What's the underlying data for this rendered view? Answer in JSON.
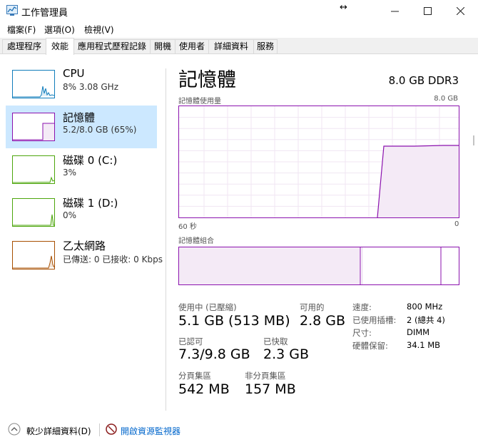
{
  "window": {
    "title": "工作管理員"
  },
  "menu": [
    "檔案(F)",
    "選項(O)",
    "檢視(V)"
  ],
  "tabs": [
    "處理程序",
    "效能",
    "應用程式歷程記錄",
    "開機",
    "使用者",
    "詳細資料",
    "服務"
  ],
  "devices": [
    {
      "name": "CPU",
      "sub": "8% 3.08 GHz",
      "color": "#117dbb"
    },
    {
      "name": "記憶體",
      "sub": "5.2/8.0 GB (65%)",
      "color": "#8b12ae"
    },
    {
      "name": "磁碟 0 (C:)",
      "sub": "3%",
      "color": "#4da60c"
    },
    {
      "name": "磁碟 1 (D:)",
      "sub": "0%",
      "color": "#4da60c"
    },
    {
      "name": "乙太網路",
      "sub": "已傳送: 0 已接收: 0 Kbps",
      "color": "#a74f01"
    }
  ],
  "main": {
    "title": "記憶體",
    "info": "8.0 GB DDR3",
    "usage_label": "記憶體使用量",
    "usage_max": "8.0 GB",
    "axis_left": "60 秒",
    "axis_right": "0",
    "composition_label": "記憶體組合"
  },
  "stats": {
    "in_use_label": "使用中 (已壓縮)",
    "in_use_value": "5.1 GB (513 MB)",
    "available_label": "可用的",
    "available_value": "2.8 GB",
    "committed_label": "已認可",
    "committed_value": "7.3/9.8 GB",
    "cached_label": "已快取",
    "cached_value": "2.3 GB",
    "paged_label": "分頁集區",
    "paged_value": "542 MB",
    "nonpaged_label": "非分頁集區",
    "nonpaged_value": "157 MB"
  },
  "specs": [
    {
      "label": "速度:",
      "value": "800 MHz"
    },
    {
      "label": "已使用插槽:",
      "value": "2 (總共 4)"
    },
    {
      "label": "尺寸:",
      "value": "DIMM"
    },
    {
      "label": "硬體保留:",
      "value": "34.1 MB"
    }
  ],
  "footer": {
    "fewer_details": "較少詳細資料(D)",
    "open_monitor": "開啟資源監視器"
  }
}
